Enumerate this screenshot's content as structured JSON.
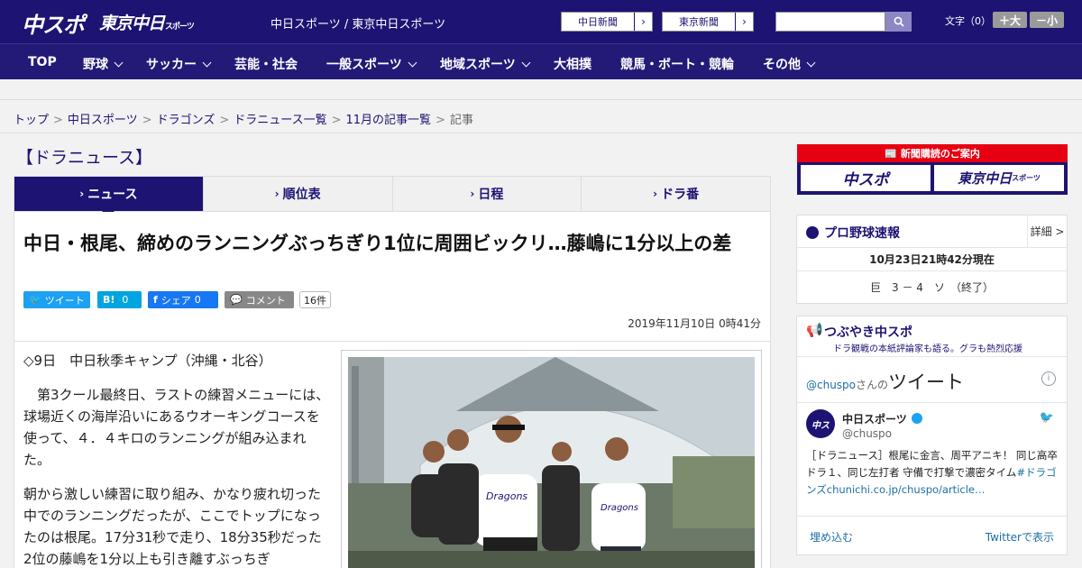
{
  "header": {
    "logo_chuspo": "中スポ",
    "logo_tokyo": "東京中日",
    "logo_tokyo_sub": "スポーツ",
    "site_title": "中日スポーツ / 東京中日スポーツ",
    "chunichi_btn": "中日新聞",
    "tokyo_btn": "東京新聞",
    "search_placeholder": "",
    "font_label": "文字（0）",
    "font_larger": "＋大",
    "font_smaller": "－小"
  },
  "nav": {
    "items": [
      "TOP",
      "野球",
      "サッカー",
      "芸能・社会",
      "一般スポーツ",
      "地域スポーツ",
      "大相撲",
      "競馬・ボート・競輪",
      "その他"
    ]
  },
  "breadcrumb": {
    "items": [
      "トップ",
      "中日スポーツ",
      "ドラゴンズ",
      "ドラニュース一覧",
      "11月の記事一覧"
    ],
    "current": "記事"
  },
  "section_title": "【ドラニュース】",
  "tabs": [
    "ニュース",
    "順位表",
    "日程",
    "ドラ番"
  ],
  "article": {
    "headline": "中日・根尾、締めのランニングぶっちぎり1位に周囲ビックリ…藤嶋に1分以上の差",
    "share": {
      "tweet": "ツイート",
      "hatena_icon": "B!",
      "hatena_count": "0",
      "facebook": "シェア",
      "facebook_count": "0",
      "comment": "コメント",
      "comment_count": "16件"
    },
    "date": "2019年11月10日 0時41分",
    "paragraphs": [
      "◇9日　中日秋季キャンプ（沖縄・北谷）",
      "　第3クール最終日、ラストの練習メニューには、球場近くの海岸沿いにあるウオーキングコースを使って、４．４キロのランニングが組み込まれた。",
      "朝から激しい練習に取り組み、かなり疲れ切った中でのランニングだったが、ここでトップになったのは根尾。17分31秒で走り、18分35秒だった2位の藤嶋を1分以上も引き離すぶっちぎ"
    ]
  },
  "sidebar": {
    "ad": {
      "top": "新聞購読のご案内",
      "logo1": "中スポ",
      "logo2": "東京中日",
      "logo2_sub": "スポーツ"
    },
    "score": {
      "title": "プロ野球速報",
      "more": "詳細 >",
      "time": "10月23日21時42分現在",
      "result": "巨　3 － 4　ソ　（終了）"
    },
    "tweets": {
      "title": "つぶやき中スポ",
      "sub": "ドラ観戦の本紙評論家も語る。グラも熱烈応援",
      "handle_label": "@chuspo",
      "san": "さんの",
      "tweet_word": "ツイート",
      "account_name": "中日スポーツ",
      "account_handle": "@chuspo",
      "tweet_text": "［ドラニュース］根尾に金言、周平アニキ！ 同じ高卒ドラ１、同じ左打者 守備で打撃で濃密タイム",
      "tweet_hashtag": "#ドラゴンズ",
      "tweet_link": "chunichi.co.jp/chuspo/article…",
      "embed": "埋め込む",
      "view_on_twitter": "Twitterで表示"
    }
  },
  "colors": {
    "brand": "#1d1373",
    "twitter": "#1da1f2",
    "hatena": "#00a4de",
    "facebook": "#1877f2",
    "ad_red": "#e60012"
  }
}
